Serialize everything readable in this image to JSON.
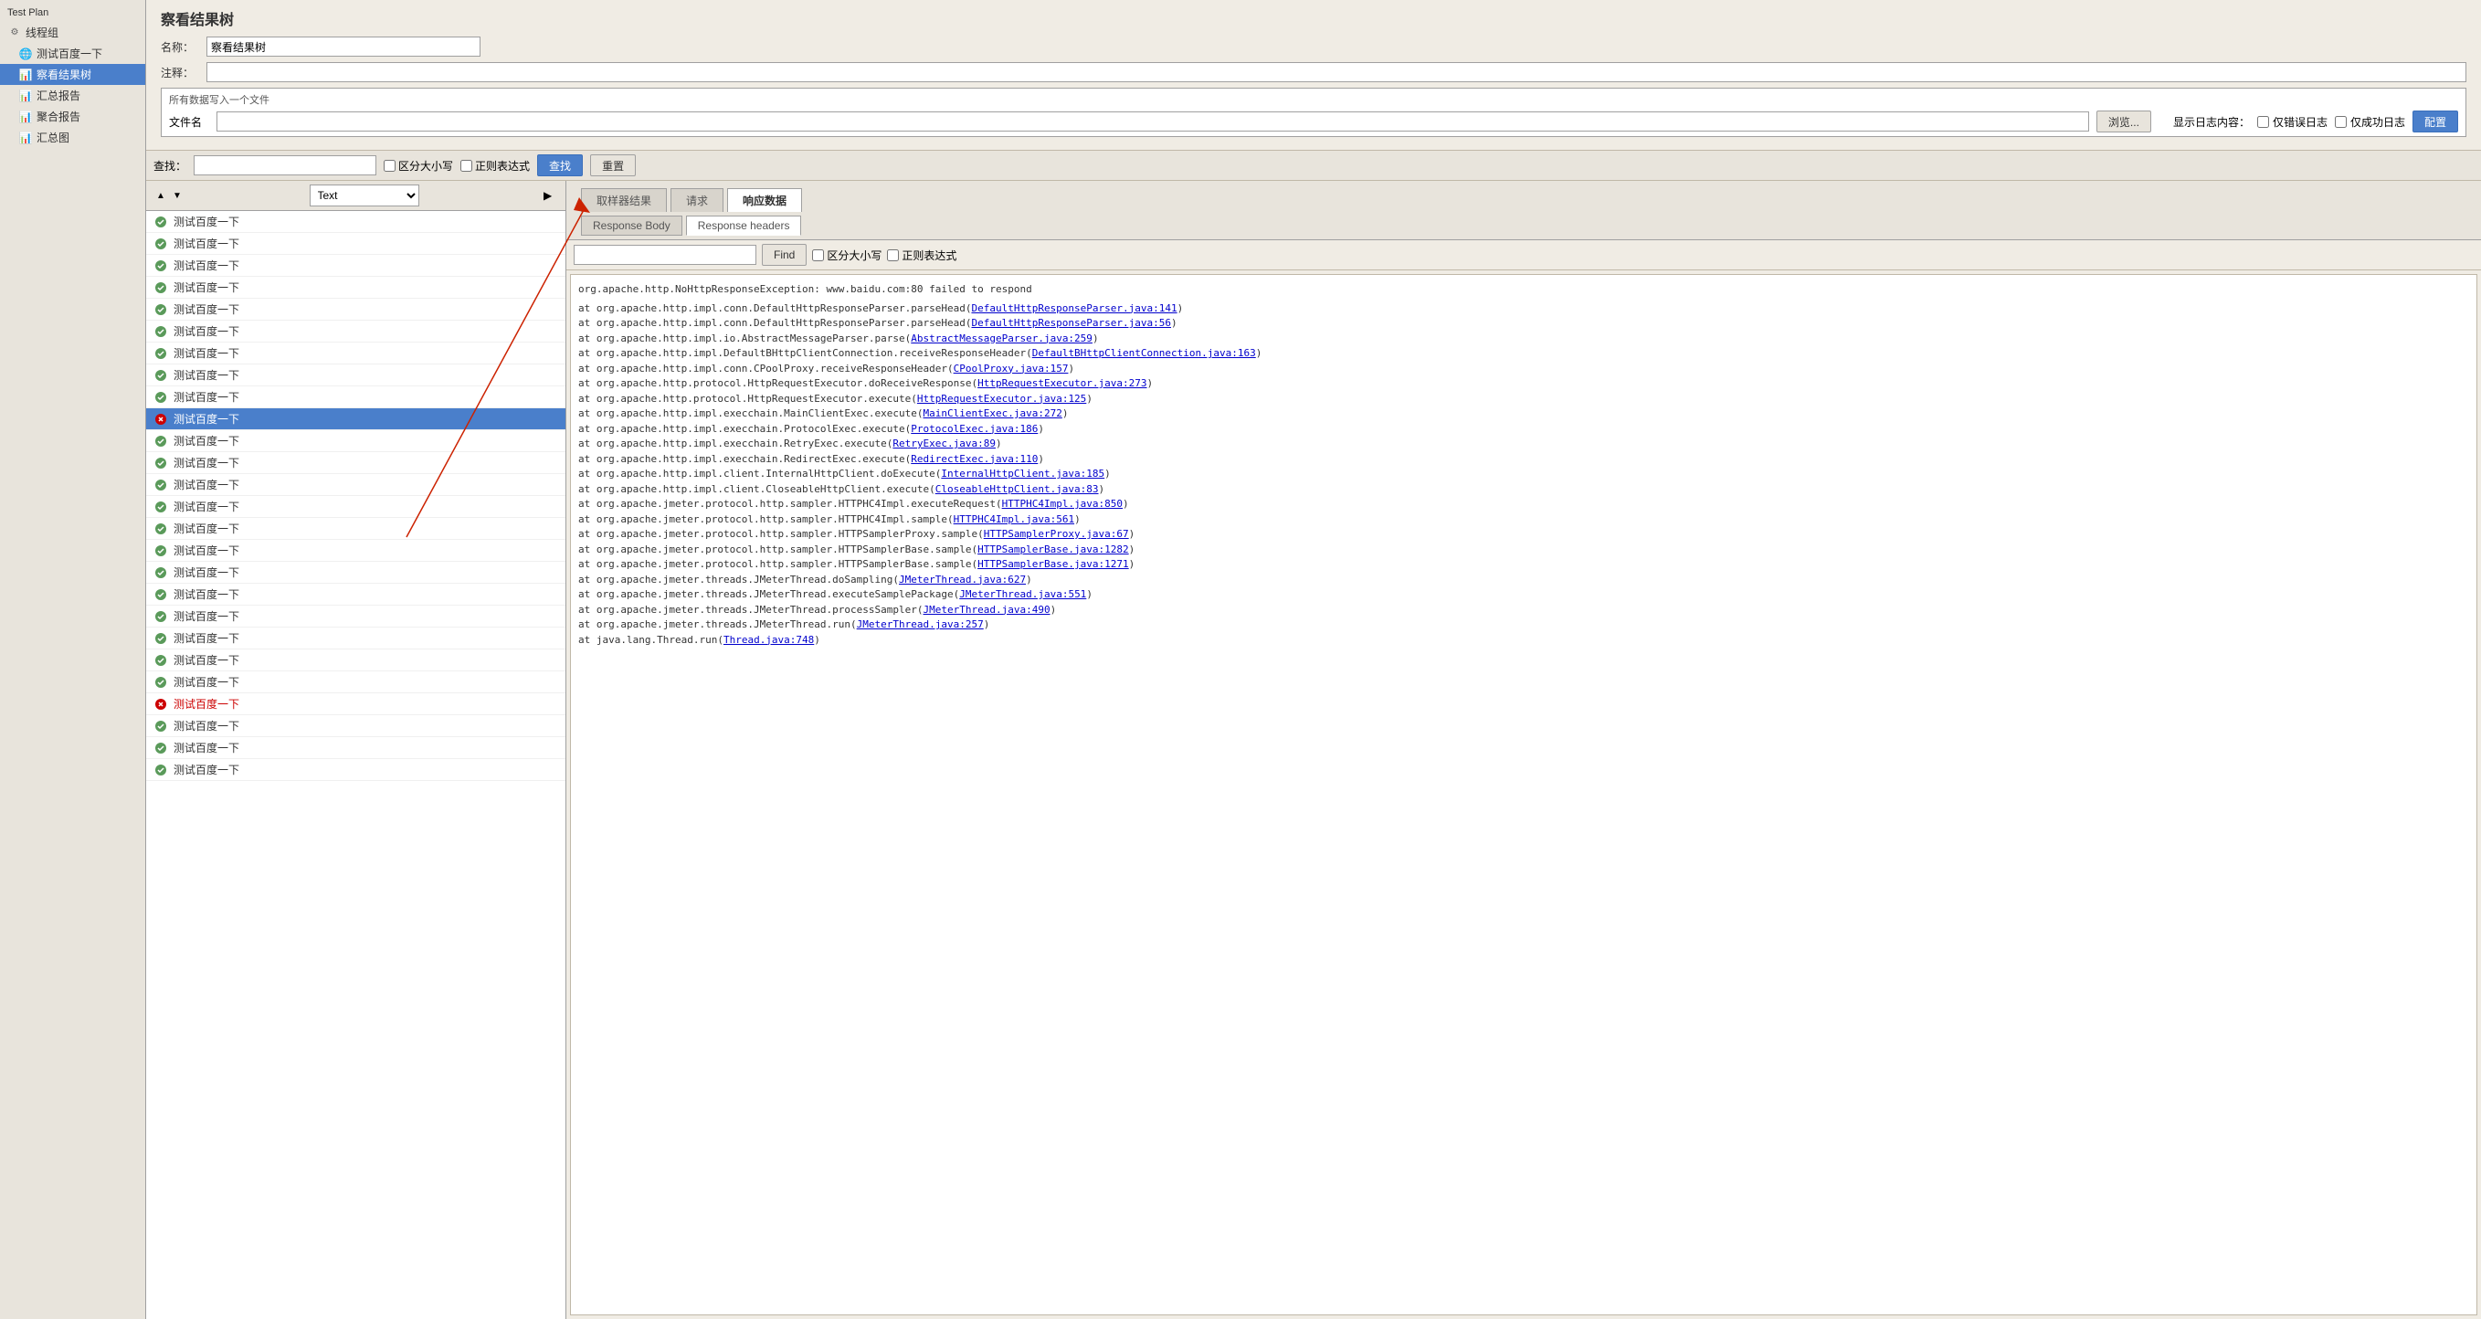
{
  "sidebar": {
    "title": "Test Plan",
    "items": [
      {
        "id": "thread-group",
        "label": "线程组",
        "icon": "thread",
        "active": false
      },
      {
        "id": "baidu-sampler",
        "label": "测试百度一下",
        "icon": "sampler",
        "active": false
      },
      {
        "id": "result-tree",
        "label": "察看结果树",
        "icon": "listener",
        "active": true
      },
      {
        "id": "summary-report",
        "label": "汇总报告",
        "icon": "listener",
        "active": false
      },
      {
        "id": "aggregate-report",
        "label": "聚合报告",
        "icon": "listener",
        "active": false
      },
      {
        "id": "summary-graph",
        "label": "汇总图",
        "icon": "listener",
        "active": false
      }
    ]
  },
  "header": {
    "title": "察看结果树",
    "name_label": "名称：",
    "name_value": "察看结果树",
    "comment_label": "注释：",
    "comment_value": "",
    "file_section_title": "所有数据写入一个文件",
    "file_label": "文件名",
    "file_value": "",
    "browse_btn": "浏览...",
    "log_label": "显示日志内容：",
    "error_only_label": "仅错误日志",
    "success_only_label": "仅成功日志",
    "config_btn": "配置"
  },
  "toolbar": {
    "search_label": "查找：",
    "search_value": "",
    "case_sensitive_label": "区分大小写",
    "regex_label": "正则表达式",
    "find_btn": "查找",
    "reset_btn": "重置"
  },
  "list": {
    "format_label": "Text",
    "items": [
      {
        "status": "ok",
        "label": "测试百度一下"
      },
      {
        "status": "ok",
        "label": "测试百度一下"
      },
      {
        "status": "ok",
        "label": "测试百度一下"
      },
      {
        "status": "ok",
        "label": "测试百度一下"
      },
      {
        "status": "ok",
        "label": "测试百度一下"
      },
      {
        "status": "ok",
        "label": "测试百度一下"
      },
      {
        "status": "ok",
        "label": "测试百度一下"
      },
      {
        "status": "ok",
        "label": "测试百度一下"
      },
      {
        "status": "ok",
        "label": "测试百度一下"
      },
      {
        "status": "err",
        "label": "测试百度一下",
        "selected": true
      },
      {
        "status": "ok",
        "label": "测试百度一下"
      },
      {
        "status": "ok",
        "label": "测试百度一下"
      },
      {
        "status": "ok",
        "label": "测试百度一下"
      },
      {
        "status": "ok",
        "label": "测试百度一下"
      },
      {
        "status": "ok",
        "label": "测试百度一下"
      },
      {
        "status": "ok",
        "label": "测试百度一下"
      },
      {
        "status": "ok",
        "label": "测试百度一下"
      },
      {
        "status": "ok",
        "label": "测试百度一下"
      },
      {
        "status": "ok",
        "label": "测试百度一下"
      },
      {
        "status": "ok",
        "label": "测试百度一下"
      },
      {
        "status": "ok",
        "label": "测试百度一下"
      },
      {
        "status": "ok",
        "label": "测试百度一下"
      },
      {
        "status": "err",
        "label": "测试百度一下"
      },
      {
        "status": "ok",
        "label": "测试百度一下"
      },
      {
        "status": "ok",
        "label": "测试百度一下"
      },
      {
        "status": "ok",
        "label": "测试百度一下"
      }
    ]
  },
  "detail": {
    "tab_sampler_result": "取样器结果",
    "tab_request": "请求",
    "tab_response_data": "响应数据",
    "response_body_btn": "Response Body",
    "response_headers_btn": "Response headers",
    "find_label": "Find",
    "find_placeholder": "",
    "case_sensitive_label": "区分大小写",
    "regex_label": "正则表达式",
    "error_text": "org.apache.http.NoHttpResponseException: www.baidu.com:80 failed to respond",
    "stack_trace": [
      "\tat org.apache.http.impl.conn.DefaultHttpResponseParser.parseHead(DefaultHttpResponseParser.java:141)",
      "\tat org.apache.http.impl.conn.DefaultHttpResponseParser.parseHead(DefaultHttpResponseParser.java:56)",
      "\tat org.apache.http.impl.io.AbstractMessageParser.parse(AbstractMessageParser.java:259)",
      "\tat org.apache.http.impl.DefaultBHttpClientConnection.receiveResponseHeader(DefaultBHttpClientConnection.java:163)",
      "\tat org.apache.http.impl.conn.CPoolProxy.receiveResponseHeader(CPoolProxy.java:157)",
      "\tat org.apache.http.protocol.HttpRequestExecutor.doReceiveResponse(HttpRequestExecutor.java:273)",
      "\tat org.apache.http.protocol.HttpRequestExecutor.execute(HttpRequestExecutor.java:125)",
      "\tat org.apache.http.impl.execchain.MainClientExec.execute(MainClientExec.java:272)",
      "\tat org.apache.http.impl.execchain.ProtocolExec.execute(ProtocolExec.java:186)",
      "\tat org.apache.http.impl.execchain.RetryExec.execute(RetryExec.java:89)",
      "\tat org.apache.http.impl.execchain.RedirectExec.execute(RedirectExec.java:110)",
      "\tat org.apache.http.impl.client.InternalHttpClient.doExecute(InternalHttpClient.java:185)",
      "\tat org.apache.http.impl.client.CloseableHttpClient.execute(CloseableHttpClient.java:83)",
      "\tat org.apache.jmeter.protocol.http.sampler.HTTPHC4Impl.executeRequest(HTTPHC4Impl.java:850)",
      "\tat org.apache.jmeter.protocol.http.sampler.HTTPHC4Impl.sample(HTTPHC4Impl.java:561)",
      "\tat org.apache.jmeter.protocol.http.sampler.HTTPSamplerProxy.sample(HTTPSamplerProxy.java:67)",
      "\tat org.apache.jmeter.protocol.http.sampler.HTTPSamplerBase.sample(HTTPSamplerBase.java:1282)",
      "\tat org.apache.jmeter.protocol.http.sampler.HTTPSamplerBase.sample(HTTPSamplerBase.java:1271)",
      "\tat org.apache.jmeter.threads.JMeterThread.doSampling(JMeterThread.java:627)",
      "\tat org.apache.jmeter.threads.JMeterThread.executeSamplePackage(JMeterThread.java:551)",
      "\tat org.apache.jmeter.threads.JMeterThread.processSampler(JMeterThread.java:490)",
      "\tat org.apache.jmeter.threads.JMeterThread.run(JMeterThread.java:257)",
      "\tat java.lang.Thread.run(Thread.java:748)"
    ]
  }
}
